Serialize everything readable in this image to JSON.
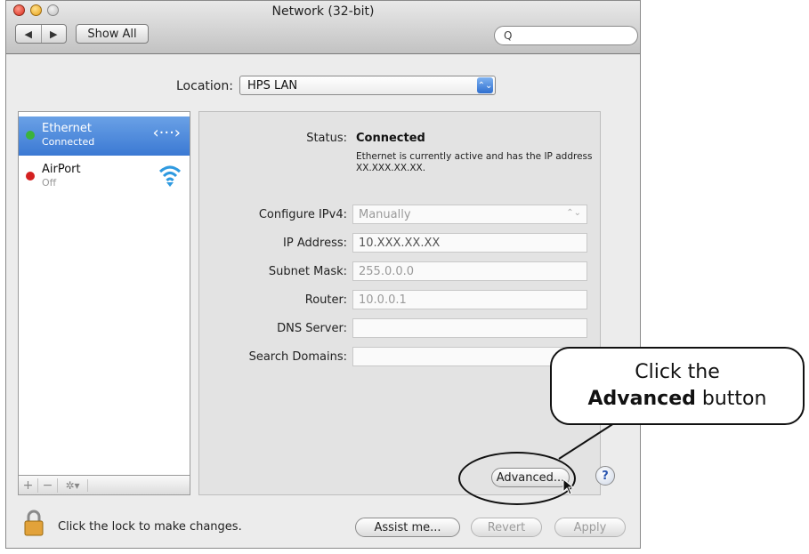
{
  "window": {
    "title": "Network (32-bit)",
    "show_all": "Show All",
    "back_glyph": "◀",
    "forward_glyph": "▶",
    "search_glyph": "Q"
  },
  "location": {
    "label": "Location:",
    "value": "HPS LAN"
  },
  "services": [
    {
      "name": "Ethernet",
      "status": "Connected",
      "status_color": "#3bb33b",
      "icon": "ethernet-arrows-icon",
      "glyph": "‹···›",
      "selected": true
    },
    {
      "name": "AirPort",
      "status": "Off",
      "status_color": "#d42020",
      "icon": "wifi-icon",
      "selected": false
    }
  ],
  "sidebar_toolbar": {
    "add": "+",
    "remove": "−",
    "gear": "✲▾"
  },
  "details": {
    "status_label": "Status:",
    "status_value": "Connected",
    "status_desc": "Ethernet is currently active and has the IP address XX.XXX.XX.XX.",
    "configure_label": "Configure IPv4:",
    "configure_value": "Manually",
    "configure_arrow": "⌃⌄",
    "ip_label": "IP Address:",
    "ip_value": "10.XXX.XX.XX",
    "subnet_label": "Subnet Mask:",
    "subnet_value": "255.0.0.0",
    "router_label": "Router:",
    "router_value": "10.0.0.1",
    "dns_label": "DNS Server:",
    "dns_value": "",
    "search_domains_label": "Search Domains:",
    "search_domains_value": ""
  },
  "buttons": {
    "advanced": "Advanced...",
    "help": "?",
    "assist": "Assist me...",
    "revert": "Revert",
    "apply": "Apply"
  },
  "lock_text": "Click the lock to make changes.",
  "callout": {
    "line1": "Click the",
    "bold": "Advanced",
    "rest": "button"
  },
  "colors": {
    "selection_blue": "#3b79d3",
    "accent_blue": "#2f6fd0"
  }
}
